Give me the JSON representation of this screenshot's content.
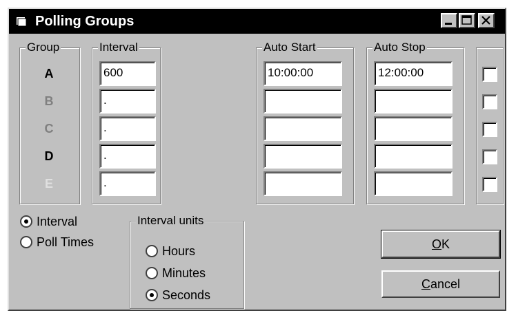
{
  "window": {
    "title": "Polling Groups"
  },
  "titlebar_buttons": [
    "minimize-button",
    "maximize-button",
    "close-button"
  ],
  "group": {
    "legend": "Group",
    "letters": [
      {
        "label": "A",
        "color": "#000000"
      },
      {
        "label": "B",
        "color": "#808080"
      },
      {
        "label": "C",
        "color": "#808080"
      },
      {
        "label": "D",
        "color": "#000000"
      },
      {
        "label": "E",
        "color": "#e0e0e0"
      }
    ]
  },
  "interval": {
    "legend": "Interval",
    "values": [
      "600",
      ".",
      ".",
      ".",
      "."
    ]
  },
  "auto_start": {
    "legend": "Auto Start",
    "values": [
      "10:00:00",
      "",
      "",
      "",
      ""
    ]
  },
  "auto_stop": {
    "legend": "Auto Stop",
    "values": [
      "12:00:00",
      "",
      "",
      "",
      ""
    ]
  },
  "enabled": [
    false,
    false,
    false,
    false,
    false
  ],
  "mode": {
    "options": [
      {
        "label": "Interval",
        "selected": true
      },
      {
        "label": "Poll Times",
        "selected": false
      }
    ]
  },
  "interval_units": {
    "legend": "Interval units",
    "options": [
      {
        "label": "Hours",
        "selected": false
      },
      {
        "label": "Minutes",
        "selected": false
      },
      {
        "label": "Seconds",
        "selected": true
      }
    ]
  },
  "buttons": {
    "ok": "OK",
    "cancel": "Cancel"
  }
}
